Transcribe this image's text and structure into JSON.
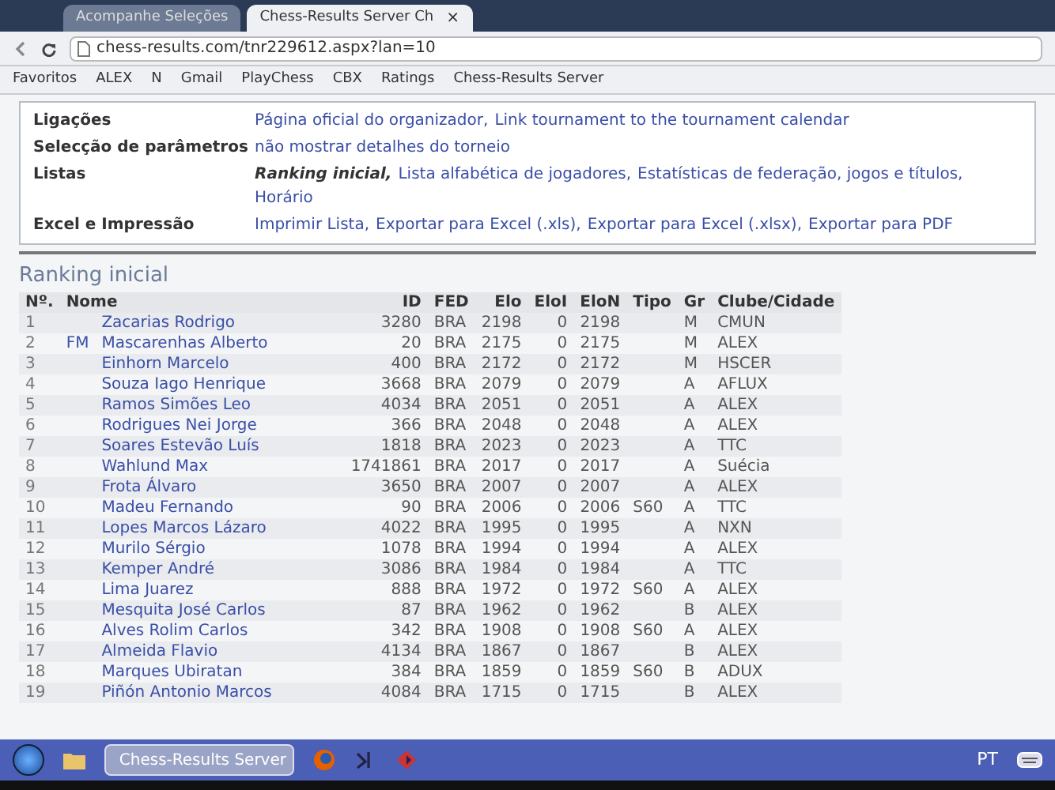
{
  "browser": {
    "tabs": [
      {
        "label": "Acompanhe Seleções",
        "selected": false
      },
      {
        "label": "Chess-Results Server Ch",
        "selected": true
      }
    ],
    "close_label": "×",
    "url": "chess-results.com/tnr229612.aspx?lan=10",
    "bookmarks": [
      "Favoritos",
      "ALEX",
      "N",
      "Gmail",
      "PlayChess",
      "CBX",
      "Ratings",
      "Chess-Results Server"
    ]
  },
  "info": [
    {
      "label": "Ligações",
      "links": [
        {
          "text": "Página oficial do organizador,",
          "current": false
        },
        {
          "text": "Link tournament to the tournament calendar",
          "current": false
        }
      ]
    },
    {
      "label": "Selecção de parâmetros",
      "links": [
        {
          "text": "não mostrar detalhes do torneio",
          "current": false
        }
      ]
    },
    {
      "label": "Listas",
      "links": [
        {
          "text": "Ranking inicial,",
          "current": true
        },
        {
          "text": "Lista alfabética de jogadores,",
          "current": false
        },
        {
          "text": "Estatísticas de federação, jogos e títulos,",
          "current": false
        },
        {
          "text": "Horário",
          "current": false
        }
      ]
    },
    {
      "label": "Excel e Impressão",
      "links": [
        {
          "text": "Imprimir Lista,",
          "current": false
        },
        {
          "text": "Exportar para Excel (.xls),",
          "current": false
        },
        {
          "text": "Exportar para Excel (.xlsx),",
          "current": false
        },
        {
          "text": "Exportar para PDF",
          "current": false
        }
      ]
    }
  ],
  "ranking": {
    "title": "Ranking inicial",
    "columns": [
      "Nº.",
      "Nome",
      "ID",
      "FED",
      "Elo",
      "EloI",
      "EloN",
      "Tipo",
      "Gr",
      "Clube/Cidade"
    ],
    "rows": [
      {
        "no": "1",
        "name": "Zacarias Rodrigo",
        "id": "3280",
        "fed": "BRA",
        "elo": "2198",
        "elo_i": "0",
        "elo_n": "2198",
        "gr": "M",
        "club": "CMUN"
      },
      {
        "no": "2",
        "title": "FM",
        "name": "Mascarenhas Alberto",
        "id": "20",
        "fed": "BRA",
        "elo": "2175",
        "elo_i": "0",
        "elo_n": "2175",
        "gr": "M",
        "club": "ALEX"
      },
      {
        "no": "3",
        "name": "Einhorn Marcelo",
        "id": "400",
        "fed": "BRA",
        "elo": "2172",
        "elo_i": "0",
        "elo_n": "2172",
        "gr": "M",
        "club": "HSCER"
      },
      {
        "no": "4",
        "name": "Souza Iago Henrique",
        "id": "3668",
        "fed": "BRA",
        "elo": "2079",
        "elo_i": "0",
        "elo_n": "2079",
        "gr": "A",
        "club": "AFLUX"
      },
      {
        "no": "5",
        "name": "Ramos Simões Leo",
        "id": "4034",
        "fed": "BRA",
        "elo": "2051",
        "elo_i": "0",
        "elo_n": "2051",
        "gr": "A",
        "club": "ALEX"
      },
      {
        "no": "6",
        "name": "Rodrigues Nei Jorge",
        "id": "366",
        "fed": "BRA",
        "elo": "2048",
        "elo_i": "0",
        "elo_n": "2048",
        "gr": "A",
        "club": "ALEX"
      },
      {
        "no": "7",
        "name": "Soares Estevão Luís",
        "id": "1818",
        "fed": "BRA",
        "elo": "2023",
        "elo_i": "0",
        "elo_n": "2023",
        "gr": "A",
        "club": "TTC"
      },
      {
        "no": "8",
        "name": "Wahlund Max",
        "id": "1741861",
        "fed": "BRA",
        "elo": "2017",
        "elo_i": "0",
        "elo_n": "2017",
        "gr": "A",
        "club": "Suécia"
      },
      {
        "no": "9",
        "name": "Frota Álvaro",
        "id": "3650",
        "fed": "BRA",
        "elo": "2007",
        "elo_i": "0",
        "elo_n": "2007",
        "gr": "A",
        "club": "ALEX"
      },
      {
        "no": "10",
        "name": "Madeu Fernando",
        "id": "90",
        "fed": "BRA",
        "elo": "2006",
        "elo_i": "0",
        "elo_n": "2006",
        "tipo": "S60",
        "gr": "A",
        "club": "TTC"
      },
      {
        "no": "11",
        "name": "Lopes Marcos Lázaro",
        "id": "4022",
        "fed": "BRA",
        "elo": "1995",
        "elo_i": "0",
        "elo_n": "1995",
        "gr": "A",
        "club": "NXN"
      },
      {
        "no": "12",
        "name": "Murilo Sérgio",
        "id": "1078",
        "fed": "BRA",
        "elo": "1994",
        "elo_i": "0",
        "elo_n": "1994",
        "gr": "A",
        "club": "ALEX"
      },
      {
        "no": "13",
        "name": "Kemper André",
        "id": "3086",
        "fed": "BRA",
        "elo": "1984",
        "elo_i": "0",
        "elo_n": "1984",
        "gr": "A",
        "club": "TTC"
      },
      {
        "no": "14",
        "name": "Lima Juarez",
        "id": "888",
        "fed": "BRA",
        "elo": "1972",
        "elo_i": "0",
        "elo_n": "1972",
        "tipo": "S60",
        "gr": "A",
        "club": "ALEX"
      },
      {
        "no": "15",
        "name": "Mesquita José Carlos",
        "id": "87",
        "fed": "BRA",
        "elo": "1962",
        "elo_i": "0",
        "elo_n": "1962",
        "gr": "B",
        "club": "ALEX"
      },
      {
        "no": "16",
        "name": "Alves Rolim Carlos",
        "id": "342",
        "fed": "BRA",
        "elo": "1908",
        "elo_i": "0",
        "elo_n": "1908",
        "tipo": "S60",
        "gr": "A",
        "club": "ALEX"
      },
      {
        "no": "17",
        "name": "Almeida Flavio",
        "id": "4134",
        "fed": "BRA",
        "elo": "1867",
        "elo_i": "0",
        "elo_n": "1867",
        "gr": "B",
        "club": "ALEX"
      },
      {
        "no": "18",
        "name": "Marques Ubiratan",
        "id": "384",
        "fed": "BRA",
        "elo": "1859",
        "elo_i": "0",
        "elo_n": "1859",
        "tipo": "S60",
        "gr": "B",
        "club": "ADUX"
      },
      {
        "no": "19",
        "name": "Piñón Antonio Marcos",
        "id": "4084",
        "fed": "BRA",
        "elo": "1715",
        "elo_i": "0",
        "elo_n": "1715",
        "gr": "B",
        "club": "ALEX"
      }
    ]
  },
  "taskbar": {
    "task": "Chess-Results Server",
    "language": "PT"
  }
}
